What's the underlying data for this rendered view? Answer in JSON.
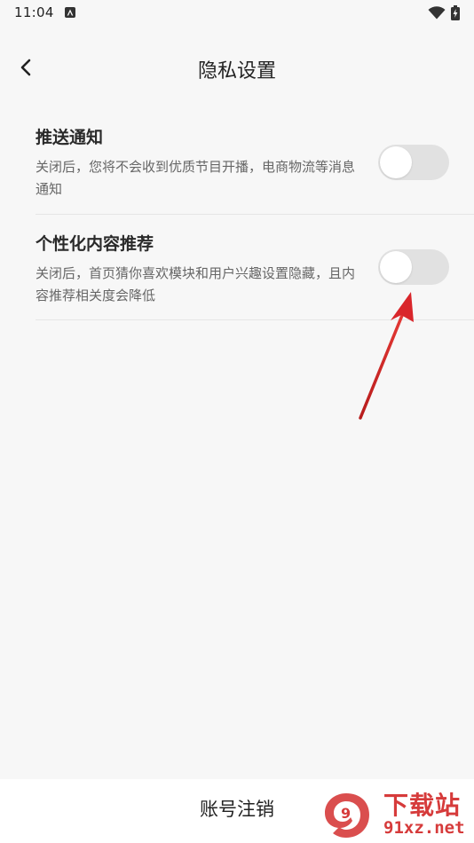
{
  "status_bar": {
    "time": "11:04",
    "app_icon": "a-square-icon",
    "icons": [
      "wifi-icon",
      "battery-charging-icon"
    ]
  },
  "header": {
    "back_icon": "chevron-left-icon",
    "title": "隐私设置"
  },
  "settings": [
    {
      "title": "推送通知",
      "description": "关闭后，您将不会收到优质节目开播，电商物流等消息通知",
      "enabled": false
    },
    {
      "title": "个性化内容推荐",
      "description": "关闭后，首页猜你喜欢模块和用户兴趣设置隐藏，且内容推荐相关度会降低",
      "enabled": false
    }
  ],
  "footer": {
    "cancel_account_label": "账号注销"
  },
  "watermark": {
    "title": "下载站",
    "url": "91xz.net",
    "logo_text": "9"
  },
  "colors": {
    "background": "#f7f7f7",
    "toggle_off": "#e1e1e1",
    "accent_red": "#d63b3b",
    "arrow_red": "#d9262b"
  }
}
